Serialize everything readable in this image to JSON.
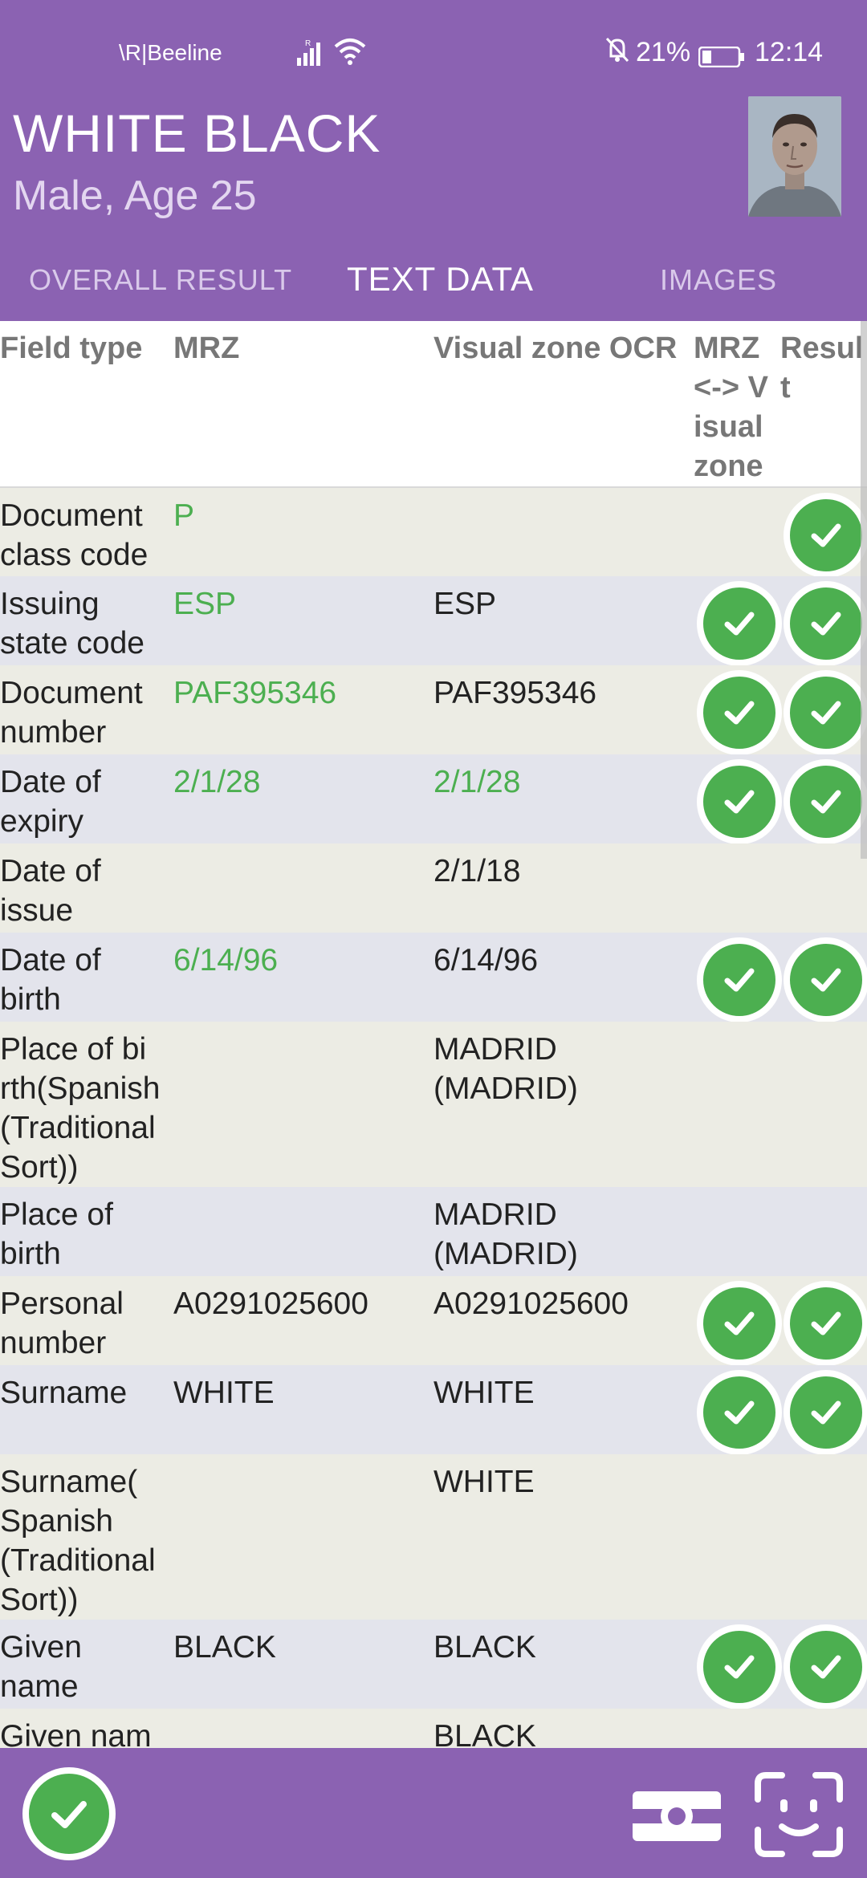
{
  "status": {
    "carrier": "\\R|Beeline",
    "battery_pct": "21%",
    "time": "12:14"
  },
  "header": {
    "name": "WHITE BLACK",
    "subtitle": "Male, Age 25"
  },
  "tabs": [
    "OVERALL RESULT",
    "TEXT DATA",
    "IMAGES"
  ],
  "table": {
    "columns": {
      "field": "Field type",
      "mrz": "MRZ",
      "viz": "Visual zone OCR",
      "compare": "MRZ <-> V isual zone",
      "result": "Resul t"
    },
    "rows": [
      {
        "field": "Document class code",
        "mrz": "P",
        "viz": "",
        "compare": false,
        "result": true
      },
      {
        "field": "Issuing state code",
        "mrz": "ESP",
        "viz": "ESP",
        "compare": true,
        "result": true
      },
      {
        "field": "Document number",
        "mrz": "PAF395346",
        "viz": "PAF395346",
        "compare": true,
        "result": true
      },
      {
        "field": "Date of expiry",
        "mrz": "2/1/28",
        "viz": "2/1/28",
        "compare": true,
        "result": true
      },
      {
        "field": "Date of issue",
        "mrz": "",
        "viz": "2/1/18",
        "compare": false,
        "result": false
      },
      {
        "field": "Date of birth",
        "mrz": "6/14/96",
        "viz": "6/14/96",
        "compare": true,
        "result": true
      },
      {
        "field": "Place of bi rth(Spanish (Traditional Sort))",
        "mrz": "",
        "viz": "MADRID (MADRID)",
        "compare": false,
        "result": false
      },
      {
        "field": "Place of birth",
        "mrz": "",
        "viz": "MADRID (MADRID)",
        "compare": false,
        "result": false
      },
      {
        "field": "Personal number",
        "mrz": "A0291025600",
        "viz": "A0291025600",
        "compare": true,
        "result": true
      },
      {
        "field": "Surname",
        "mrz": "WHITE",
        "viz": "WHITE",
        "compare": true,
        "result": true
      },
      {
        "field": "Surname( Spanish (Traditional Sort))",
        "mrz": "",
        "viz": "WHITE",
        "compare": false,
        "result": false
      },
      {
        "field": "Given name",
        "mrz": "BLACK",
        "viz": "BLACK",
        "compare": true,
        "result": true
      },
      {
        "field": "Given nam",
        "mrz": "",
        "viz": "BLACK",
        "compare": false,
        "result": false
      }
    ]
  },
  "colors": {
    "primary": "#8b62b2",
    "success": "#4caf50",
    "row_even": "#e3e4ec",
    "row_odd": "#ecece4"
  },
  "icons": {
    "fab": "check-icon",
    "camera": "camera-icon",
    "face": "face-scan-icon"
  }
}
